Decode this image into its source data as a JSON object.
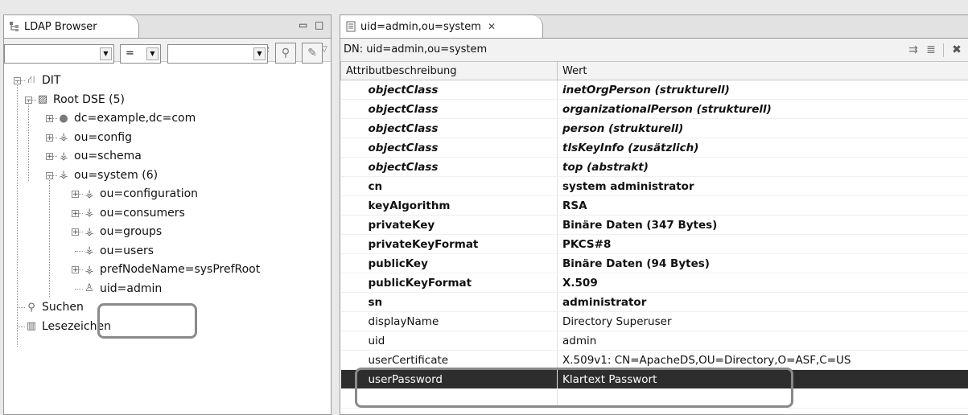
{
  "left_panel": {
    "tab_title": "LDAP Browser",
    "minimize_glyph": "▭",
    "maximize_glyph": "□",
    "toolbar_icons": [
      "refresh-icon",
      "link-icon",
      "collapse-all-icon",
      "link-with-editor-icon",
      "view-menu-icon"
    ],
    "filter": {
      "attribute_value": "",
      "operator_value": "=",
      "filter_value": ""
    },
    "tree": [
      {
        "label": "DIT",
        "icon": "dit-icon",
        "level": 0,
        "expanded": true
      },
      {
        "label": "Root DSE (5)",
        "icon": "root-dse-icon",
        "level": 1,
        "expanded": true
      },
      {
        "label": "dc=example,dc=com",
        "icon": "globe-icon",
        "level": 2,
        "expanded": false
      },
      {
        "label": "ou=config",
        "icon": "org-unit-icon",
        "level": 2,
        "expanded": false
      },
      {
        "label": "ou=schema",
        "icon": "org-unit-icon",
        "level": 2,
        "expanded": false
      },
      {
        "label": "ou=system (6)",
        "icon": "org-unit-icon",
        "level": 2,
        "expanded": true
      },
      {
        "label": "ou=configuration",
        "icon": "org-unit-icon",
        "level": 3,
        "expanded": false
      },
      {
        "label": "ou=consumers",
        "icon": "org-unit-icon",
        "level": 3,
        "expanded": false
      },
      {
        "label": "ou=groups",
        "icon": "org-unit-icon",
        "level": 3,
        "expanded": false
      },
      {
        "label": "ou=users",
        "icon": "org-unit-icon",
        "level": 3,
        "expanded": null
      },
      {
        "label": "prefNodeName=sysPrefRoot",
        "icon": "org-unit-icon",
        "level": 3,
        "expanded": false
      },
      {
        "label": "uid=admin",
        "icon": "person-icon",
        "level": 3,
        "expanded": null
      },
      {
        "label": "Suchen",
        "icon": "search-icon",
        "level": 0,
        "expanded": null
      },
      {
        "label": "Lesezeichen",
        "icon": "bookmark-icon",
        "level": 0,
        "expanded": null
      }
    ]
  },
  "editor": {
    "tab_title": "uid=admin,ou=system",
    "close_glyph": "✕",
    "dn_label": "DN: uid=admin,ou=system",
    "toolbar_icons": [
      "new-value-icon",
      "new-attribute-icon",
      "delete-icon"
    ],
    "columns": [
      "Attributbeschreibung",
      "Wert"
    ],
    "rows": [
      {
        "attr": "objectClass",
        "value": "inetOrgPerson (strukturell)",
        "style": "bold-italic"
      },
      {
        "attr": "objectClass",
        "value": "organizationalPerson (strukturell)",
        "style": "bold-italic"
      },
      {
        "attr": "objectClass",
        "value": "person (strukturell)",
        "style": "bold-italic"
      },
      {
        "attr": "objectClass",
        "value": "tlsKeyInfo (zusätzlich)",
        "style": "bold-italic"
      },
      {
        "attr": "objectClass",
        "value": "top (abstrakt)",
        "style": "bold-italic"
      },
      {
        "attr": "cn",
        "value": "system administrator",
        "style": "bold"
      },
      {
        "attr": "keyAlgorithm",
        "value": "RSA",
        "style": "bold"
      },
      {
        "attr": "privateKey",
        "value": "Binäre Daten (347 Bytes)",
        "style": "bold"
      },
      {
        "attr": "privateKeyFormat",
        "value": "PKCS#8",
        "style": "bold"
      },
      {
        "attr": "publicKey",
        "value": "Binäre Daten (94 Bytes)",
        "style": "bold"
      },
      {
        "attr": "publicKeyFormat",
        "value": "X.509",
        "style": "bold"
      },
      {
        "attr": "sn",
        "value": "administrator",
        "style": "bold"
      },
      {
        "attr": "displayName",
        "value": "Directory Superuser",
        "style": "normal"
      },
      {
        "attr": "uid",
        "value": "admin",
        "style": "normal"
      },
      {
        "attr": "userCertificate",
        "value": "X.509v1: CN=ApacheDS,OU=Directory,O=ASF,C=US",
        "style": "normal"
      },
      {
        "attr": "userPassword",
        "value": "Klartext Passwort",
        "style": "selected"
      }
    ]
  },
  "colors": {
    "highlight_border": "#8a8a8a",
    "selected_row": "#2d2d2d"
  }
}
